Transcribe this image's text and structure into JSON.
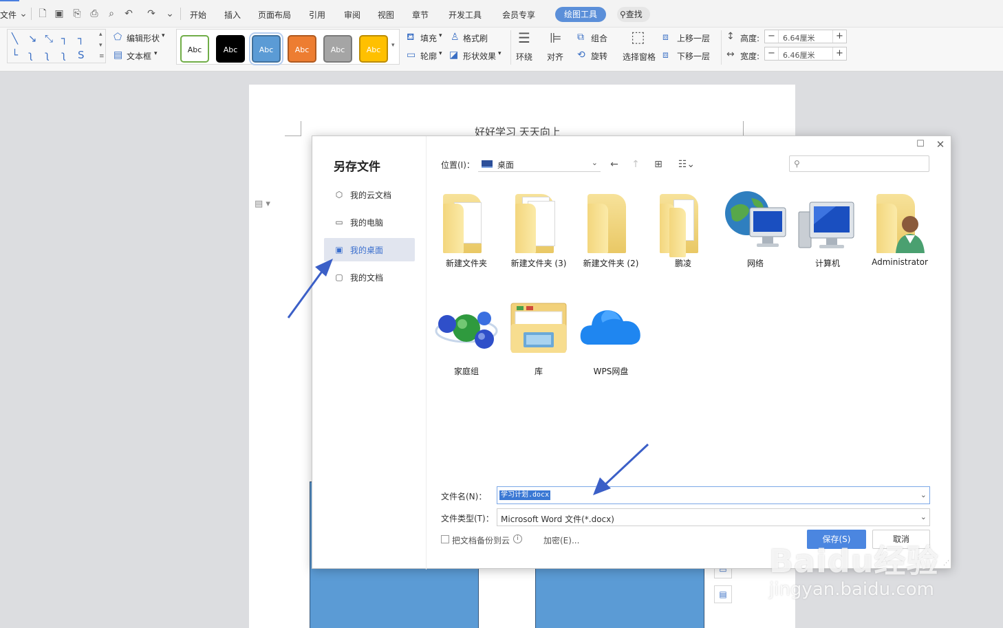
{
  "menubar": {
    "file_menu": "文件",
    "tabs": [
      "开始",
      "插入",
      "页面布局",
      "引用",
      "审阅",
      "视图",
      "章节",
      "开发工具",
      "会员专享"
    ],
    "active_tab": "绘图工具",
    "search": "查找"
  },
  "ribbon": {
    "edit_shape": "编辑形状",
    "text_box": "文本框",
    "style_presets": [
      {
        "label": "Abc",
        "bg": "#ffffff",
        "fg": "#222222",
        "border": "#70ad47"
      },
      {
        "label": "Abc",
        "bg": "#000000",
        "fg": "#ffffff",
        "border": "#000000"
      },
      {
        "label": "Abc",
        "bg": "#5b9bd5",
        "fg": "#ffffff",
        "border": "#41719c"
      },
      {
        "label": "Abc",
        "bg": "#ed7d31",
        "fg": "#ffffff",
        "border": "#ae5a21"
      },
      {
        "label": "Abc",
        "bg": "#a5a5a5",
        "fg": "#ffffff",
        "border": "#7a7a7a"
      },
      {
        "label": "Abc",
        "bg": "#ffc000",
        "fg": "#ffffff",
        "border": "#bc8c00"
      }
    ],
    "fill": "填充",
    "format_painter": "格式刷",
    "outline": "轮廓",
    "shape_effect": "形状效果",
    "wrap": "环绕",
    "align": "对齐",
    "group": "组合",
    "rotate": "旋转",
    "selection_pane": "选择窗格",
    "bring_forward": "上移一层",
    "send_backward": "下移一层",
    "height_label": "高度:",
    "height_value": "6.64厘米",
    "width_label": "宽度:",
    "width_value": "6.46厘米"
  },
  "document": {
    "header_text": "好好学习 天天向上"
  },
  "dialog": {
    "title": "另存文件",
    "sidebar": [
      {
        "label": "我的云文档",
        "icon": "cloud-doc-icon",
        "active": false
      },
      {
        "label": "我的电脑",
        "icon": "computer-icon",
        "active": false
      },
      {
        "label": "我的桌面",
        "icon": "desktop-icon",
        "active": true
      },
      {
        "label": "我的文档",
        "icon": "documents-icon",
        "active": false
      }
    ],
    "location_label": "位置(I)：",
    "location_value": "桌面",
    "files": [
      {
        "label": "新建文件夹",
        "kind": "folder-docs"
      },
      {
        "label": "新建文件夹 (3)",
        "kind": "folder-papers"
      },
      {
        "label": "新建文件夹 (2)",
        "kind": "folder-empty"
      },
      {
        "label": "鹏凌",
        "kind": "folder-stack"
      },
      {
        "label": "网络",
        "kind": "network"
      },
      {
        "label": "计算机",
        "kind": "computer"
      },
      {
        "label": "Administrator",
        "kind": "user-folder"
      },
      {
        "label": "家庭组",
        "kind": "homegroup"
      },
      {
        "label": "库",
        "kind": "library"
      },
      {
        "label": "WPS网盘",
        "kind": "wps-cloud"
      }
    ],
    "filename_label": "文件名(N)：",
    "filename_value": "学习计划.docx",
    "filetype_label": "文件类型(T)：",
    "filetype_value": "Microsoft Word 文件(*.docx)",
    "backup_label": "把文档备份到云",
    "encrypt_label": "加密(E)...",
    "save_label": "保存(S)",
    "cancel_label": "取消"
  },
  "watermark": {
    "logo": "Baidu经验",
    "url": "jingyan.baidu.com"
  },
  "colors": {
    "accent": "#4b86e0",
    "tab_active": "#5b8fd9",
    "arrow": "#3b5fc7",
    "shape_fill": "#5b9bd5"
  }
}
